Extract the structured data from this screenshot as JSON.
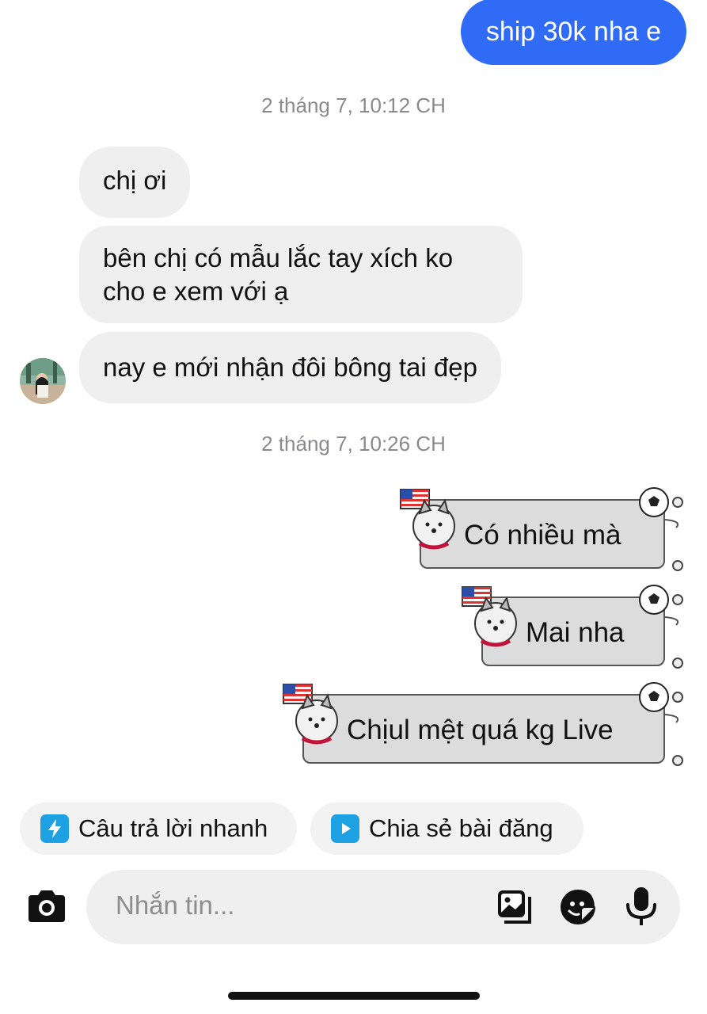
{
  "messages": {
    "outgoing_top": "ship 30k nha e",
    "timestamp_1": "2 tháng 7, 10:12 CH",
    "incoming_1": "chị ơi",
    "incoming_2_line1": "bên chị có mẫu lắc tay xích ko",
    "incoming_2_line2": "cho e xem với ạ",
    "incoming_3": "nay e mới nhận đôi bông tai đẹp",
    "timestamp_2": "2 tháng 7, 10:26 CH",
    "sticker_1": "Có nhiều mà",
    "sticker_2": "Mai nha",
    "sticker_3": "Chịul mệt quá kg Live"
  },
  "quick_actions": {
    "quick_reply": "Câu trả lời nhanh",
    "share_post": "Chia sẻ bài đăng"
  },
  "composer": {
    "placeholder": "Nhắn tin..."
  },
  "icons": [
    "camera-icon",
    "gallery-icon",
    "sticker-icon",
    "microphone-icon",
    "lightning-icon",
    "play-icon"
  ],
  "colors": {
    "outgoing_bubble": "#2f6bf5",
    "incoming_bubble": "#efefef",
    "quick_reply_icon": "#1ea1e3",
    "share_icon": "#1ea1e3"
  }
}
